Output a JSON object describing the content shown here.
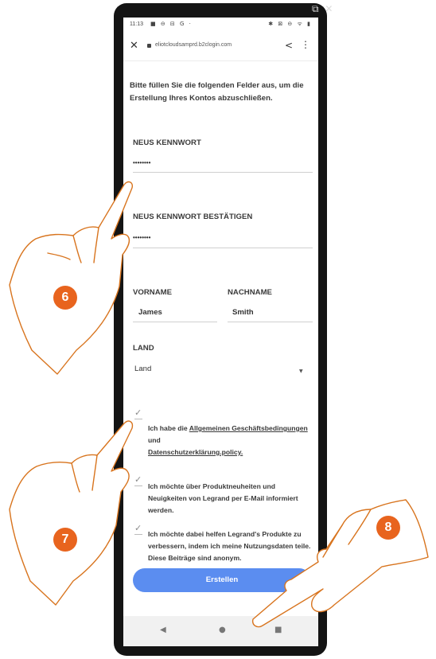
{
  "status_bar": {
    "time": "11:13",
    "icons_left": "■ ⊖ ⊟ G ·",
    "icons_right": "✱ ⊠ ⊖ ᯤ ▮"
  },
  "browser": {
    "url": "eliotcloudsamprd.b2clogin.com"
  },
  "window_controls": "⧉ ✕",
  "form": {
    "intro": "Bitte füllen Sie die folgenden Felder aus, um die Erstellung Ihres Kontos abzuschließen.",
    "new_password_label": "NEUS KENNWORT",
    "new_password_value": "••••••••",
    "confirm_password_label": "NEUS KENNWORT BESTÄTIGEN",
    "confirm_password_value": "••••••••",
    "first_name_label": "VORNAME",
    "first_name_value": "James",
    "last_name_label": "NACHNAME",
    "last_name_value": "Smith",
    "country_label": "LAND",
    "country_value": "Land",
    "terms_prefix": "Ich habe die",
    "terms_link": "Allgemeinen Geschäftsbedingungen",
    "terms_and": "und",
    "privacy_link": "Datenschutzerklärung.policy.",
    "newsletter_text": "Ich möchte über Produktneuheiten und Neuigkeiten von Legrand per E-Mail informiert werden.",
    "data_share_text": "Ich möchte dabei helfen Legrand's Produkte zu verbessern, indem ich meine Nutzungsdaten teile. Diese Beiträge sind anonym.",
    "submit_label": "Erstellen"
  },
  "nav": {
    "back": "◀",
    "home": "●",
    "recents": "■"
  },
  "callouts": {
    "step6": "6",
    "step7": "7",
    "step8": "8"
  },
  "colors": {
    "accent": "#5b8df0",
    "callout": "#e8641e",
    "hand_outline": "#d8741e"
  },
  "icons": [
    "close-icon",
    "lock-icon",
    "share-icon",
    "more-vert-icon",
    "dropdown-caret-icon",
    "check-icon",
    "back-nav-icon",
    "home-nav-icon",
    "recents-nav-icon"
  ]
}
